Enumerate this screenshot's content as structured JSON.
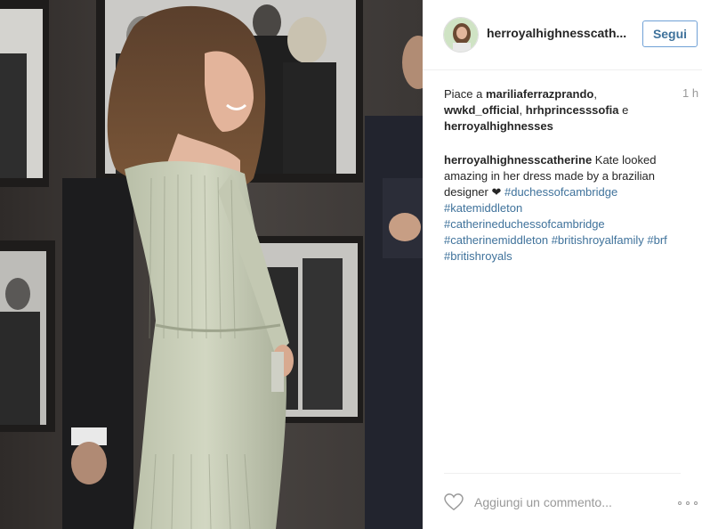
{
  "post": {
    "username": "herroyalhighnesscath...",
    "follow_label": "Segui",
    "time": "1 h",
    "likes": {
      "prefix": "Piace a ",
      "names": [
        "mariliaferrazprando",
        "wwkd_official",
        "hrhprincesssofia",
        "herroyalhighnesses"
      ],
      "sep": ", ",
      "and_word": " e "
    },
    "caption": {
      "author": "herroyalhighnesscatherine",
      "text": " Kate looked amazing in her dress made by a brazilian designer ❤ ",
      "hashtags": [
        "#duchessofcambridge",
        "#katemiddleton",
        "#catherineduchessofcambridge",
        "#catherinemiddleton",
        "#britishroyalfamily",
        "#brf",
        "#britishroyals"
      ]
    },
    "comment_placeholder": "Aggiungi un commento..."
  },
  "colors": {
    "link": "#3f729b",
    "follow_border": "#70a1d6",
    "muted": "#999999",
    "text": "#262626"
  },
  "icons": {
    "like": "heart-icon",
    "more": "more-options-icon"
  }
}
